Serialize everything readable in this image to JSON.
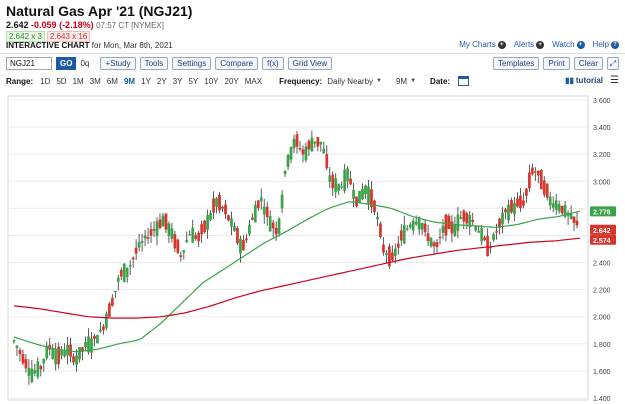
{
  "header": {
    "title": "Natural Gas Apr '21 (NGJ21)",
    "last": "2.642",
    "change": "-0.059 (-2.18%)",
    "time": "07:57 CT [NYMEX]",
    "bid": "2.642 x 3",
    "ask": "2.643 x 16",
    "interactive_label": "INTERACTIVE CHART",
    "interactive_date": "for Mon, Mar 8th, 2021"
  },
  "links": {
    "my_charts": "My Charts",
    "alerts": "Alerts",
    "watch": "Watch",
    "help": "Help"
  },
  "toolbar": {
    "symbol": "NGJ21",
    "go": "GO",
    "oq": "0q",
    "study": "+Study",
    "tools": "Tools",
    "settings": "Settings",
    "compare": "Compare",
    "fx": "f(x)",
    "grid_view": "Grid View",
    "templates": "Templates",
    "print": "Print",
    "clear": "Clear",
    "expand_icon": "expand-icon"
  },
  "range_row": {
    "range_label": "Range:",
    "ranges": [
      "1D",
      "5D",
      "1M",
      "3M",
      "6M",
      "9M",
      "1Y",
      "2Y",
      "3Y",
      "5Y",
      "10Y",
      "20Y",
      "MAX"
    ],
    "active_range": "9M",
    "frequency_label": "Frequency:",
    "frequency_value": "Daily Nearby",
    "period_value": "9M",
    "date_label": "Date:",
    "tutorial": "tutorial"
  },
  "colors": {
    "up": "#3aa34a",
    "down": "#d8342b",
    "ma_fast": "#3aa34a",
    "ma_slow": "#d0021b",
    "accent": "#1e5aa6"
  },
  "chart_data": {
    "type": "candlestick",
    "ylim": [
      1.4,
      3.6
    ],
    "yticks": [
      "1.400",
      "1.600",
      "1.800",
      "2.000",
      "2.200",
      "2.400",
      "2.600",
      "2.800",
      "3.000",
      "3.200",
      "3.400",
      "3.600"
    ],
    "grid": true,
    "candle_count": 190,
    "close_path": [
      1.82,
      1.7,
      1.58,
      1.62,
      1.78,
      1.7,
      1.76,
      1.68,
      1.78,
      1.82,
      1.9,
      2.08,
      2.3,
      2.35,
      2.5,
      2.58,
      2.65,
      2.72,
      2.6,
      2.45,
      2.62,
      2.58,
      2.7,
      2.85,
      2.78,
      2.65,
      2.5,
      2.7,
      2.88,
      2.72,
      2.62,
      3.15,
      3.3,
      3.2,
      3.3,
      3.28,
      3.0,
      2.95,
      3.05,
      2.85,
      2.95,
      2.82,
      2.5,
      2.42,
      2.58,
      2.68,
      2.72,
      2.6,
      2.5,
      2.68,
      2.65,
      2.75,
      2.72,
      2.62,
      2.5,
      2.65,
      2.78,
      2.82,
      2.85,
      3.1,
      3.0,
      2.85,
      2.82,
      2.75,
      2.68
    ],
    "ma_fast_path": [
      1.85,
      1.8,
      1.76,
      1.74,
      1.76,
      1.8,
      1.83,
      1.95,
      2.1,
      2.25,
      2.35,
      2.45,
      2.55,
      2.63,
      2.72,
      2.8,
      2.85,
      2.83,
      2.8,
      2.74,
      2.7,
      2.68,
      2.67,
      2.66,
      2.68,
      2.72,
      2.74,
      2.78
    ],
    "ma_slow_path": [
      2.08,
      2.06,
      2.03,
      2.0,
      1.99,
      1.99,
      2.0,
      2.03,
      2.08,
      2.14,
      2.19,
      2.23,
      2.27,
      2.31,
      2.35,
      2.39,
      2.43,
      2.46,
      2.49,
      2.51,
      2.53,
      2.55,
      2.56,
      2.58
    ],
    "labels": [
      {
        "value": 2.778,
        "text": "2.778",
        "color": "#3aa34a"
      },
      {
        "value": 2.642,
        "text": "2.642",
        "color": "#d8342b"
      },
      {
        "value": 2.574,
        "text": "2.574",
        "color": "#d8342b"
      }
    ]
  }
}
